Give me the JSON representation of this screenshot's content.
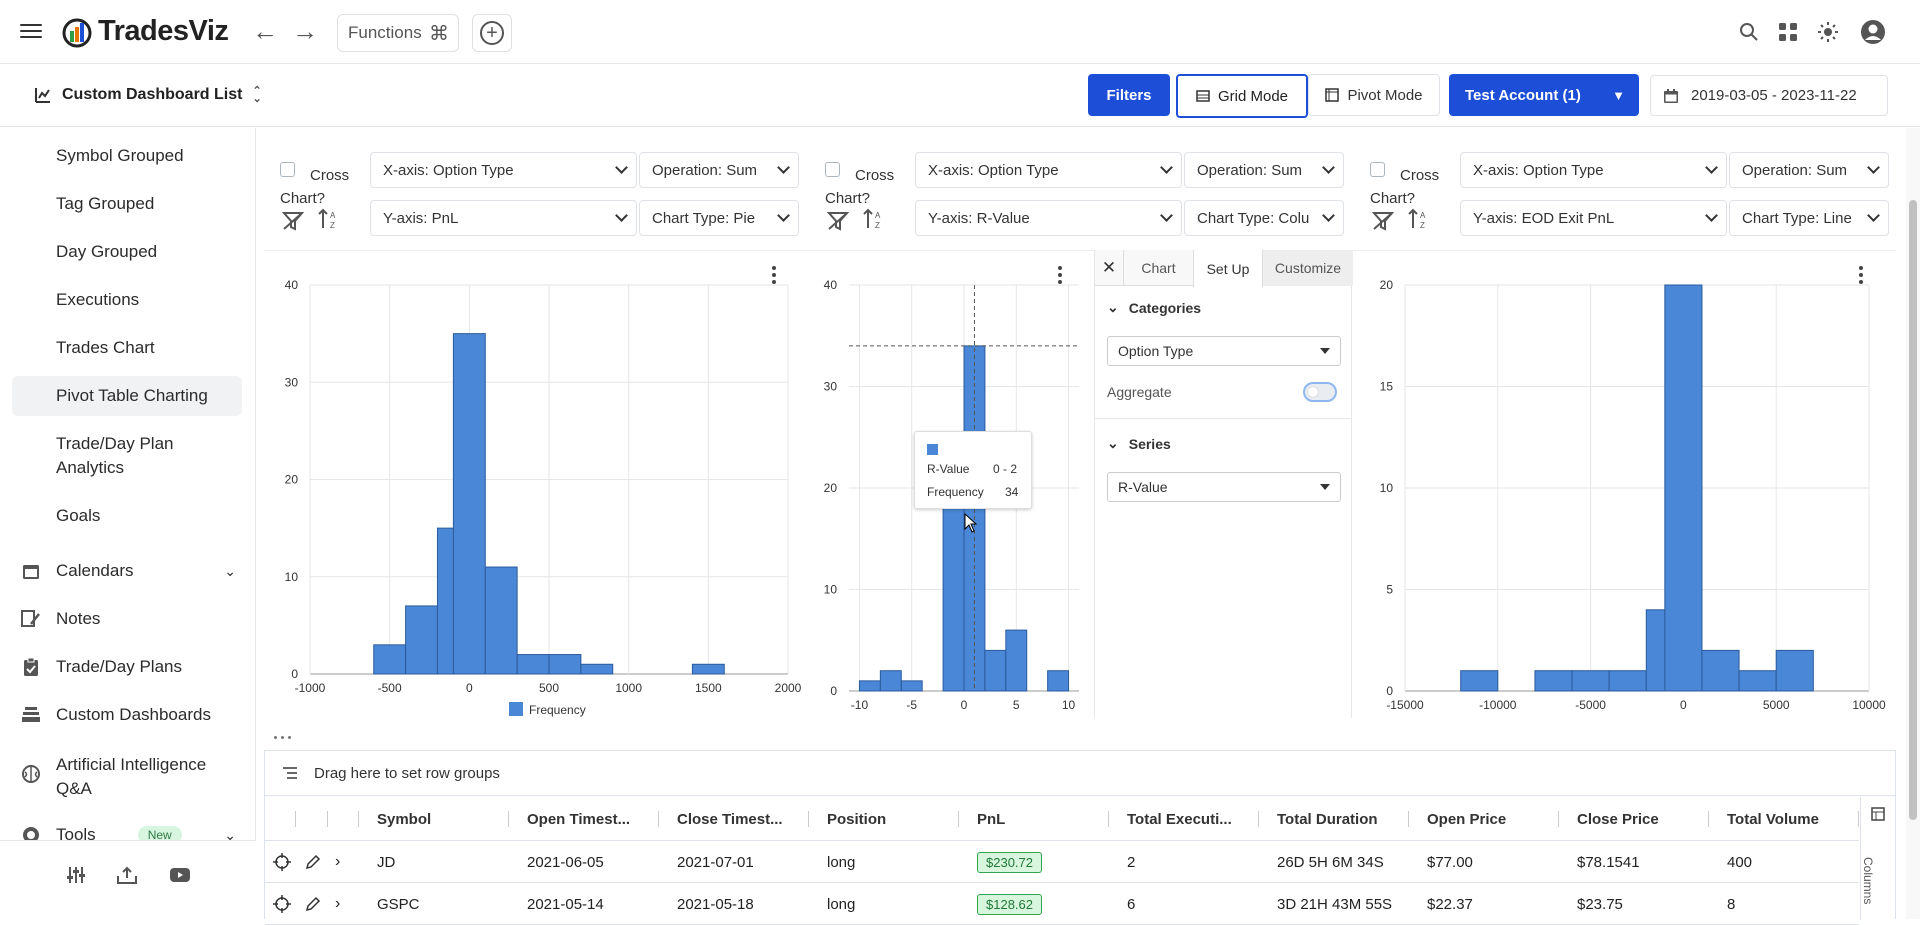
{
  "app": {
    "name": "TradesViz",
    "brand_color": "#1d4ed8"
  },
  "topbar": {
    "functions_label": "Functions",
    "icons": [
      "menu-icon",
      "back-arrow-icon",
      "forward-arrow-icon",
      "command-icon",
      "plus-circle-icon",
      "search-icon",
      "apps-grid-icon",
      "theme-sun-icon",
      "user-avatar-icon"
    ]
  },
  "subbar": {
    "dashboard_list_label": "Custom Dashboard List",
    "filters_label": "Filters",
    "grid_mode_label": "Grid Mode",
    "pivot_mode_label": "Pivot Mode",
    "account_label": "Test Account (1)",
    "date_range": "2019-03-05 - 2023-11-22"
  },
  "sidebar": {
    "sub_items": [
      "Symbol Grouped",
      "Tag Grouped",
      "Day Grouped",
      "Executions",
      "Trades Chart",
      "Pivot Table Charting",
      "Trade/Day Plan Analytics",
      "Goals"
    ],
    "active_item": "Pivot Table Charting",
    "main_items": [
      {
        "label": "Calendars",
        "icon": "calendar-icon",
        "expandable": true
      },
      {
        "label": "Notes",
        "icon": "notes-icon"
      },
      {
        "label": "Trade/Day Plans",
        "icon": "clipboard-icon"
      },
      {
        "label": "Custom Dashboards",
        "icon": "stack-icon"
      },
      {
        "label": "Artificial Intelligence Q&A",
        "icon": "brain-icon"
      },
      {
        "label": "Tools",
        "icon": "tools-icon",
        "badge": "New",
        "expandable": true
      }
    ],
    "footer_icons": [
      "sliders-icon",
      "upload-icon",
      "youtube-icon"
    ]
  },
  "panels": [
    {
      "cross_chart_label": "Cross Chart?",
      "x_axis": "X-axis: Option Type",
      "operation": "Operation: Sum",
      "y_axis": "Y-axis: PnL",
      "chart_type": "Chart Type: Pie"
    },
    {
      "cross_chart_label": "Cross Chart?",
      "x_axis": "X-axis: Option Type",
      "operation": "Operation: Sum",
      "y_axis": "Y-axis: R-Value",
      "chart_type": "Chart Type: Colu"
    },
    {
      "cross_chart_label": "Cross Chart?",
      "x_axis": "X-axis: Option Type",
      "operation": "Operation: Sum",
      "y_axis": "Y-axis: EOD Exit PnL",
      "chart_type": "Chart Type: Line"
    }
  ],
  "chart_data": [
    {
      "type": "bar",
      "bar_color": "#4a87d6",
      "legend": [
        "Frequency"
      ],
      "legend_placement": "bottom",
      "grid": true,
      "x": [
        -500,
        -300,
        -100,
        0,
        200,
        400,
        600,
        800,
        1000,
        1500
      ],
      "bin_width": 200,
      "values": [
        3,
        7,
        15,
        35,
        11,
        2,
        2,
        1,
        0,
        1
      ],
      "xlim": [
        -1000,
        2000
      ],
      "ylim": [
        0,
        40
      ],
      "xticks": [
        "-1000",
        "-500",
        "0",
        "500",
        "1000",
        "1500",
        "2000"
      ],
      "yticks": [
        "0",
        "10",
        "20",
        "30",
        "40"
      ],
      "series": [
        {
          "name": "Frequency"
        }
      ]
    },
    {
      "type": "bar",
      "bar_color": "#4a87d6",
      "grid": true,
      "x": [
        -9,
        -7,
        -5,
        -1,
        1,
        3,
        5,
        9
      ],
      "bin_width": 2,
      "values": [
        1,
        2,
        1,
        19,
        34,
        4,
        6,
        2
      ],
      "xlim": [
        -11,
        11
      ],
      "ylim": [
        0,
        40
      ],
      "xticks": [
        "-10",
        "-5",
        "0",
        "5",
        "10"
      ],
      "yticks": [
        "0",
        "10",
        "20",
        "30",
        "40"
      ],
      "tooltip": {
        "label": "R-Value",
        "range": "0 - 2",
        "freq_label": "Frequency",
        "freq": "34"
      }
    },
    {
      "type": "bar",
      "bar_color": "#4a87d6",
      "grid": true,
      "x": [
        -11000,
        -7000,
        -5000,
        -3000,
        -1000,
        0,
        2000,
        4000,
        6000
      ],
      "bin_width": 2000,
      "values": [
        1,
        1,
        1,
        1,
        4,
        20,
        2,
        1,
        2
      ],
      "xlim": [
        -15000,
        10000
      ],
      "ylim": [
        0,
        20
      ],
      "xticks": [
        "-15000",
        "-10000",
        "-5000",
        "0",
        "5000",
        "10000"
      ],
      "yticks": [
        "0",
        "5",
        "10",
        "15",
        "20"
      ]
    }
  ],
  "settings_panel": {
    "tabs": [
      "Chart",
      "Set Up",
      "Customize"
    ],
    "active_tab": "Set Up",
    "categories_label": "Categories",
    "categories_value": "Option Type",
    "aggregate_label": "Aggregate",
    "aggregate_on": false,
    "series_label": "Series",
    "series_value": "R-Value"
  },
  "grid": {
    "group_hint": "Drag here to set row groups",
    "columns": [
      "Symbol",
      "Open Timest...",
      "Close Timest...",
      "Position",
      "PnL",
      "Total Executi...",
      "Total Duration",
      "Open Price",
      "Close Price",
      "Total Volume"
    ],
    "rows": [
      [
        "JD",
        "2021-06-05",
        "2021-07-01",
        "long",
        "$230.72",
        "2",
        "26D 5H 6M 34S",
        "$77.00",
        "$78.1541",
        "400"
      ],
      [
        "GSPC",
        "2021-05-14",
        "2021-05-18",
        "long",
        "$128.62",
        "6",
        "3D 21H 43M 55S",
        "$22.37",
        "$23.75",
        "8"
      ]
    ],
    "side_label": "Columns"
  }
}
